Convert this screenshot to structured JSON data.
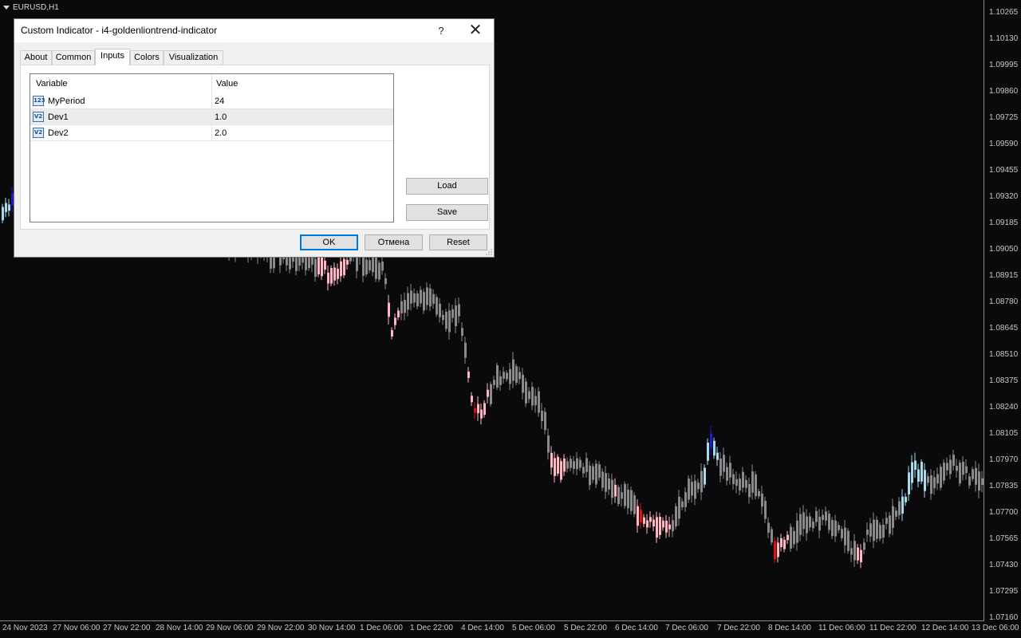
{
  "chart": {
    "symbol": "EURUSD,H1",
    "price_labels": [
      "1.10265",
      "1.10130",
      "1.09995",
      "1.09860",
      "1.09725",
      "1.09590",
      "1.09455",
      "1.09320",
      "1.09185",
      "1.09050",
      "1.08915",
      "1.08780",
      "1.08645",
      "1.08510",
      "1.08375",
      "1.08240",
      "1.08105",
      "1.07970",
      "1.07835",
      "1.07700",
      "1.07565",
      "1.07430",
      "1.07295",
      "1.07160"
    ],
    "time_labels": [
      "24 Nov 2023",
      "27 Nov 06:00",
      "27 Nov 22:00",
      "28 Nov 14:00",
      "29 Nov 06:00",
      "29 Nov 22:00",
      "30 Nov 14:00",
      "1 Dec 06:00",
      "1 Dec 22:00",
      "4 Dec 14:00",
      "5 Dec 06:00",
      "5 Dec 22:00",
      "6 Dec 14:00",
      "7 Dec 06:00",
      "7 Dec 22:00",
      "8 Dec 14:00",
      "11 Dec 06:00",
      "11 Dec 22:00",
      "12 Dec 14:00",
      "13 Dec 06:00"
    ],
    "colors": {
      "background": "#0a0a0d",
      "neutral_bar": "#8a8a8a",
      "pink_bar": "#ffb6c1",
      "red_bar": "#e01010",
      "lightblue_bar": "#a8d8ec",
      "blue_bar": "#1c1cc8"
    }
  },
  "dialog": {
    "title": "Custom Indicator - i4-goldenliontrend-indicator",
    "help": "?",
    "close_icon": "close-icon",
    "tabs": [
      {
        "label": "About"
      },
      {
        "label": "Common"
      },
      {
        "label": "Inputs"
      },
      {
        "label": "Colors"
      },
      {
        "label": "Visualization"
      }
    ],
    "active_tab": "Inputs",
    "grid": {
      "columns": [
        "Variable",
        "Value"
      ],
      "rows": [
        {
          "icon": "integer-icon",
          "icon_text": "123",
          "name": "MyPeriod",
          "value": "24"
        },
        {
          "icon": "double-icon",
          "icon_text": "V2",
          "name": "Dev1",
          "value": "1.0"
        },
        {
          "icon": "double-icon",
          "icon_text": "V2",
          "name": "Dev2",
          "value": "2.0"
        }
      ]
    },
    "load_label": "Load",
    "save_label": "Save",
    "ok_label": "OK",
    "cancel_label": "Отмена",
    "reset_label": "Reset"
  }
}
